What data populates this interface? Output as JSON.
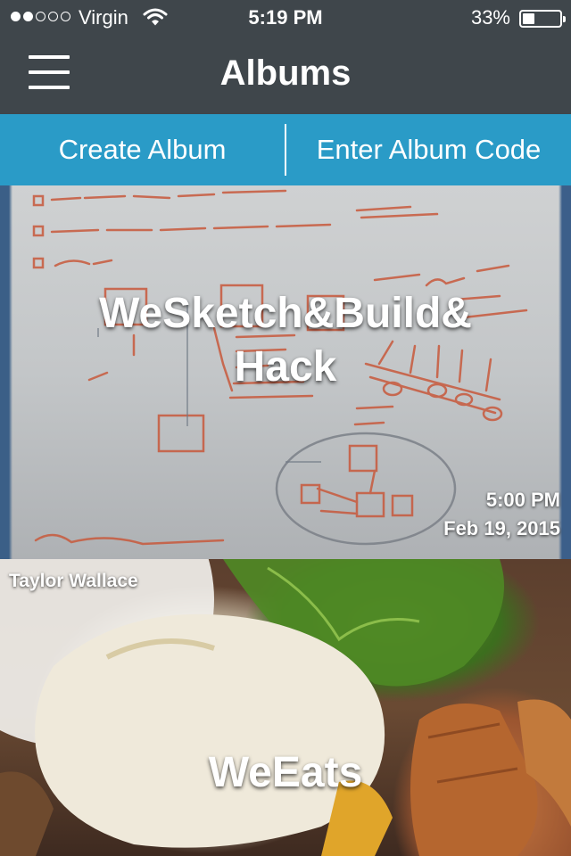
{
  "status_bar": {
    "carrier": "Virgin",
    "time": "5:19 PM",
    "battery_percent": "33%",
    "battery_level": 0.33,
    "signal_bars_filled": 2,
    "signal_bars_total": 5,
    "icons": [
      "signal-dots-icon",
      "wifi-icon",
      "battery-icon"
    ]
  },
  "nav": {
    "title": "Albums",
    "menu_icon": "hamburger-menu-icon"
  },
  "actions": {
    "create_album": "Create Album",
    "enter_code": "Enter Album Code"
  },
  "colors": {
    "nav_background": "#3f464b",
    "accent": "#2a9bc7",
    "text": "#ffffff"
  },
  "albums": [
    {
      "title_line1": "WeSketch&Build&",
      "title_line2": "Hack",
      "time": "5:00 PM",
      "date": "Feb 19, 2015",
      "image": "whiteboard-sketch-photo"
    },
    {
      "author": "Taylor Wallace",
      "title": "WeEats",
      "image": "burger-and-fries-photo"
    }
  ]
}
